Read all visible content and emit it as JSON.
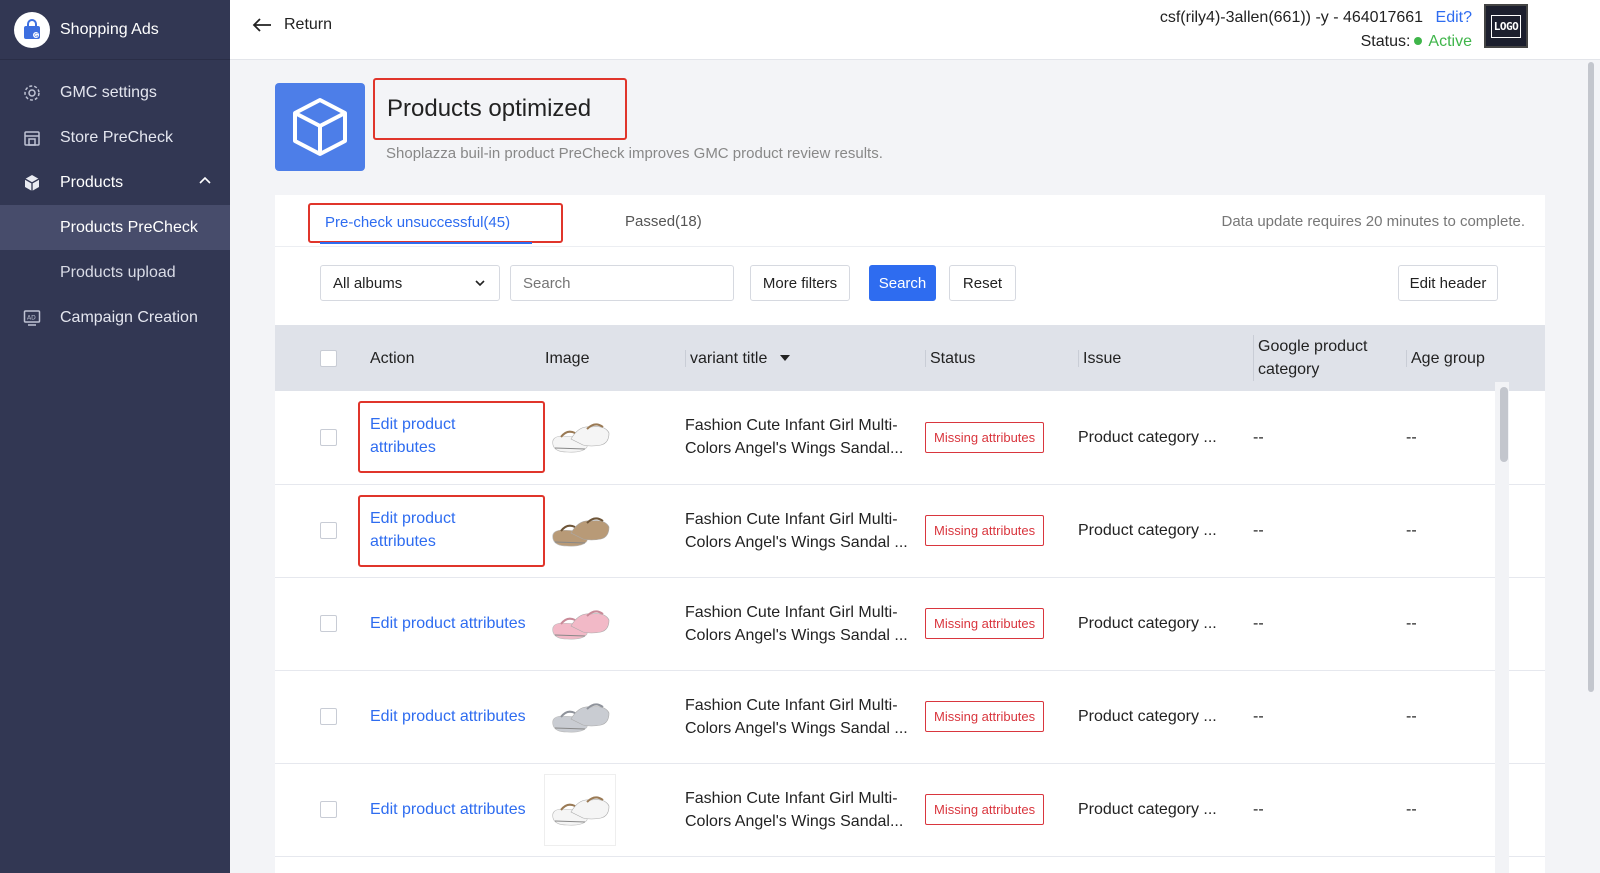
{
  "sidebar": {
    "brand": "Shopping Ads",
    "items": [
      {
        "label": "GMC settings",
        "icon": "gear-icon"
      },
      {
        "label": "Store PreCheck",
        "icon": "store-icon"
      },
      {
        "label": "Products",
        "icon": "box-icon",
        "expanded": true,
        "children": [
          {
            "label": "Products PreCheck",
            "active": true
          },
          {
            "label": "Products upload",
            "active": false
          }
        ]
      },
      {
        "label": "Campaign Creation",
        "icon": "ad-icon"
      }
    ]
  },
  "header": {
    "return_label": "Return",
    "account": "csf(rily4)-3allen(661))  -y - 464017661",
    "edit_label": "Edit?",
    "status_label": "Status:",
    "status_value": "Active",
    "logo_text": "LOGO"
  },
  "page": {
    "title": "Products optimized",
    "description": "Shoplazza buil-in product PreCheck improves GMC product review results."
  },
  "tabs": {
    "active": "Pre-check unsuccessful(45)",
    "passed": "Passed(18)",
    "note": "Data update requires 20 minutes to complete."
  },
  "filters": {
    "album_select": "All albums",
    "search_placeholder": "Search",
    "more_filters": "More filters",
    "search_button": "Search",
    "reset_button": "Reset",
    "edit_header_button": "Edit header"
  },
  "table": {
    "columns": {
      "action": "Action",
      "image": "Image",
      "variant_title": "variant title",
      "status": "Status",
      "issue": "Issue",
      "google_category": "Google product category",
      "age_group": "Age group"
    },
    "rows": [
      {
        "action": "Edit product attributes",
        "title": "Fashion Cute Infant Girl Multi-\nColors Angel's Wings Sandal...",
        "status": "Missing attributes",
        "issue": "Product category ...",
        "google_category": "--",
        "age_group": "--",
        "shoe_color": "#f5f5f5",
        "strap": "#9a7a55"
      },
      {
        "action": "Edit product attributes",
        "title": "Fashion Cute Infant Girl Multi-\nColors Angel's Wings Sandal ...",
        "status": "Missing attributes",
        "issue": "Product category ...",
        "google_category": "--",
        "age_group": "--",
        "shoe_color": "#b89a77",
        "strap": "#6e5538"
      },
      {
        "action": "Edit product attributes",
        "title": "Fashion Cute Infant Girl Multi-\nColors Angel's Wings Sandal ...",
        "status": "Missing attributes",
        "issue": "Product category ...",
        "google_category": "--",
        "age_group": "--",
        "shoe_color": "#f2b9c7",
        "strap": "#c98a98"
      },
      {
        "action": "Edit product attributes",
        "title": "Fashion Cute Infant Girl Multi-\nColors Angel's Wings Sandal ...",
        "status": "Missing attributes",
        "issue": "Product category ...",
        "google_category": "--",
        "age_group": "--",
        "shoe_color": "#c9ccd2",
        "strap": "#8f939b"
      },
      {
        "action": "Edit product attributes",
        "title": "Fashion Cute Infant Girl Multi-\nColors Angel's Wings Sandal...",
        "status": "Missing attributes",
        "issue": "Product category ...",
        "google_category": "--",
        "age_group": "--",
        "shoe_color": "#f5f5f5",
        "strap": "#9a7a55"
      }
    ]
  },
  "colors": {
    "sidebar_bg": "#323753",
    "accent": "#2e6cf0",
    "highlight": "#e0352b",
    "active_status": "#3fb54a"
  }
}
